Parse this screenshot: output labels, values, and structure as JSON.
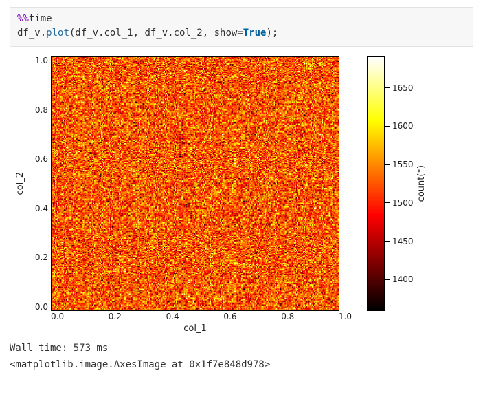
{
  "code": {
    "magic_prefix": "%%",
    "magic_name": "time",
    "line2": {
      "obj": "df_v.",
      "call": "plot",
      "open": "(df_v.col_1, df_v.col_2, ",
      "kwarg_key": "show=",
      "kwarg_val": "True",
      "close": ");"
    }
  },
  "chart_data": {
    "type": "heatmap",
    "xlabel": "col_1",
    "ylabel": "col_2",
    "xlim": [
      0.0,
      1.0
    ],
    "ylim": [
      0.0,
      1.0
    ],
    "x_ticks": [
      "0.0",
      "0.2",
      "0.4",
      "0.6",
      "0.8",
      "1.0"
    ],
    "y_ticks": [
      "1.0",
      "0.8",
      "0.6",
      "0.4",
      "0.2",
      "0.0"
    ],
    "colorbar": {
      "label": "count(*)",
      "vmin": 1360,
      "vmax": 1690,
      "ticks": [
        1400,
        1450,
        1500,
        1550,
        1600,
        1650
      ],
      "cmap": "hot"
    },
    "description": "2D density histogram of df_v.col_1 vs df_v.col_2. Random uniform scatter; per-bin counts roughly between 1360 and 1690.",
    "grid_shape": [
      256,
      256
    ],
    "value_distribution": {
      "mean": 1525,
      "std": 70,
      "min": 1360,
      "max": 1690
    }
  },
  "output": {
    "timing": "Wall time: 573 ms",
    "repr": "<matplotlib.image.AxesImage at 0x1f7e848d978>"
  }
}
